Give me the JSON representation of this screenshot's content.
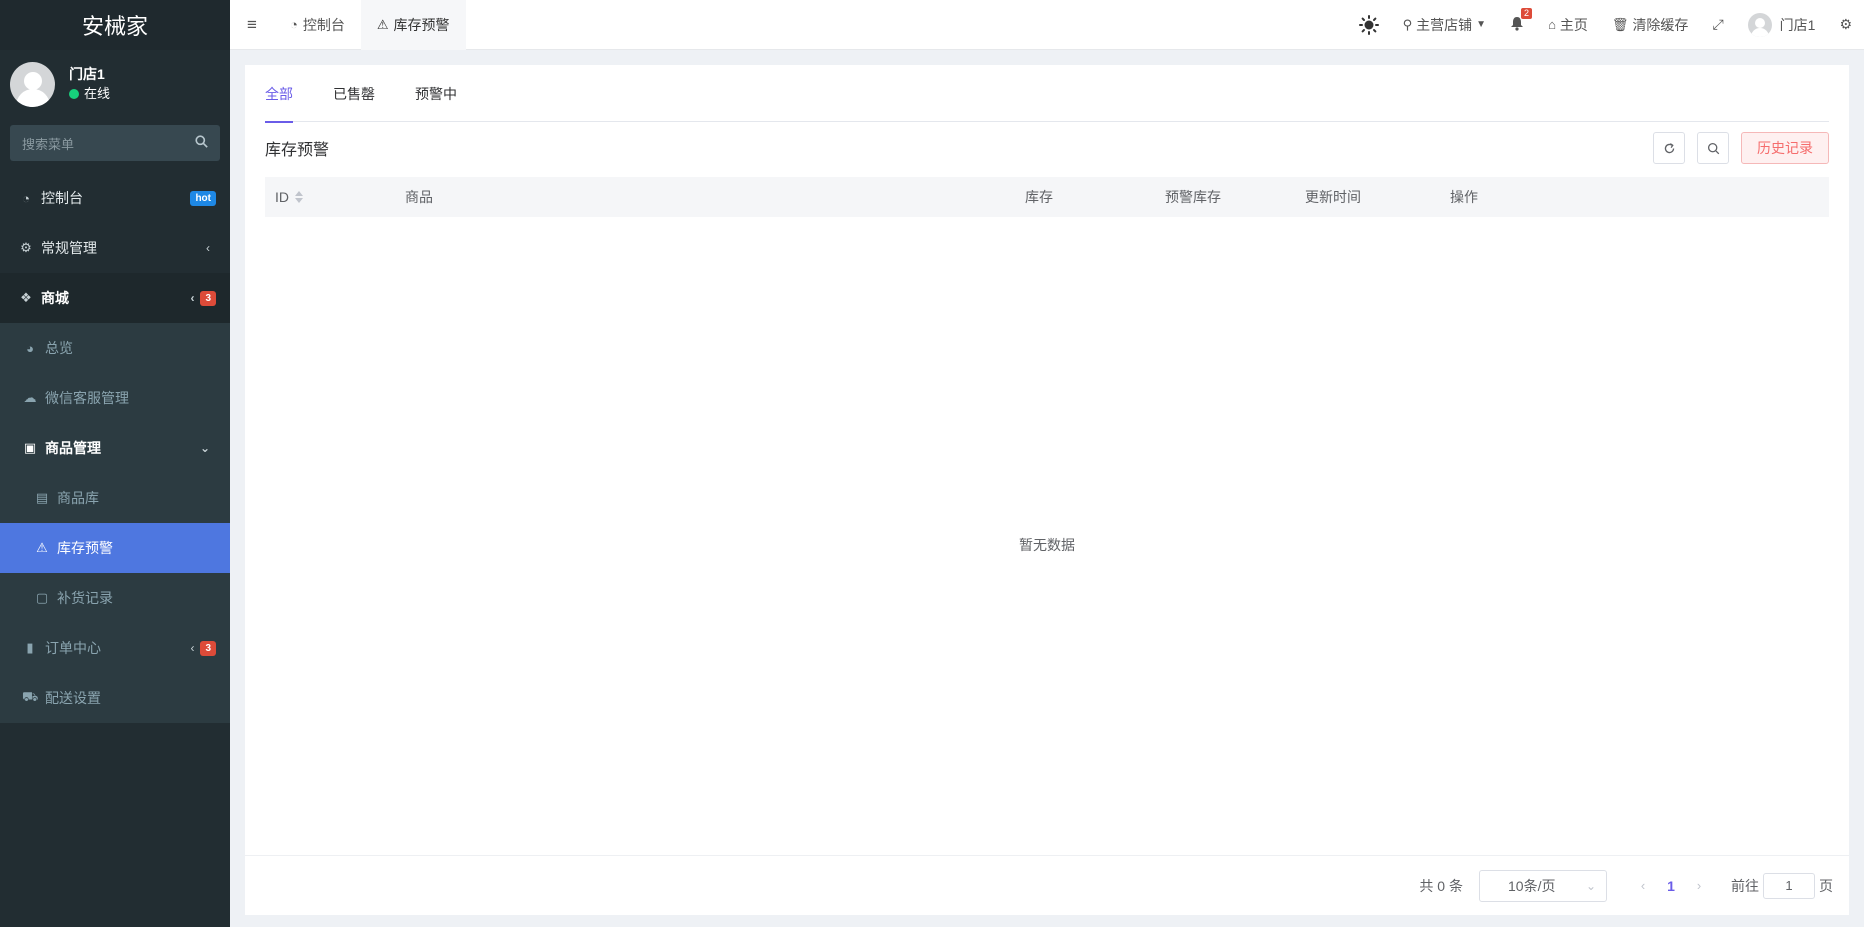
{
  "app": {
    "logo_text": "安械家"
  },
  "user": {
    "name": "门店1",
    "status": "在线"
  },
  "sidebar": {
    "search_placeholder": "搜索菜单",
    "items": [
      {
        "label": "控制台",
        "icon": "dashboard-icon",
        "badge": "hot"
      },
      {
        "label": "常规管理",
        "icon": "cogs-icon"
      },
      {
        "label": "商城",
        "icon": "dropbox-icon",
        "badge": "3"
      },
      {
        "label": "总览",
        "icon": "pie-chart-icon"
      },
      {
        "label": "微信客服管理",
        "icon": "comments-icon"
      },
      {
        "label": "商品管理",
        "icon": "archive-icon"
      },
      {
        "label": "商品库",
        "icon": "shopping-bag-icon"
      },
      {
        "label": "库存预警",
        "icon": "warning-icon"
      },
      {
        "label": "补货记录",
        "icon": "sticky-note-icon"
      },
      {
        "label": "订单中心",
        "icon": "file-icon",
        "badge": "3"
      },
      {
        "label": "配送设置",
        "icon": "car-icon"
      }
    ]
  },
  "topbar": {
    "tabs": [
      {
        "label": "控制台",
        "icon": "dashboard-icon"
      },
      {
        "label": "库存预警",
        "icon": "warning-icon"
      }
    ],
    "store_label": "主营店铺",
    "notification_count": "2",
    "home_label": "主页",
    "clear_cache_label": "清除缓存",
    "user_label": "门店1"
  },
  "content": {
    "tabs": [
      "全部",
      "已售罄",
      "预警中"
    ],
    "title": "库存预警",
    "history_button": "历史记录",
    "columns": [
      "ID",
      "商品",
      "库存",
      "预警库存",
      "更新时间",
      "操作"
    ],
    "empty_text": "暂无数据"
  },
  "pagination": {
    "total_text": "共 0 条",
    "page_size": "10条/页",
    "current_page": "1",
    "goto_prefix": "前往",
    "goto_value": "1",
    "goto_suffix": "页"
  },
  "colors": {
    "sidebar_bg": "#222d32",
    "active_menu": "#4e77e0",
    "accent": "#6a5ce8",
    "danger": "#f56c6c"
  }
}
